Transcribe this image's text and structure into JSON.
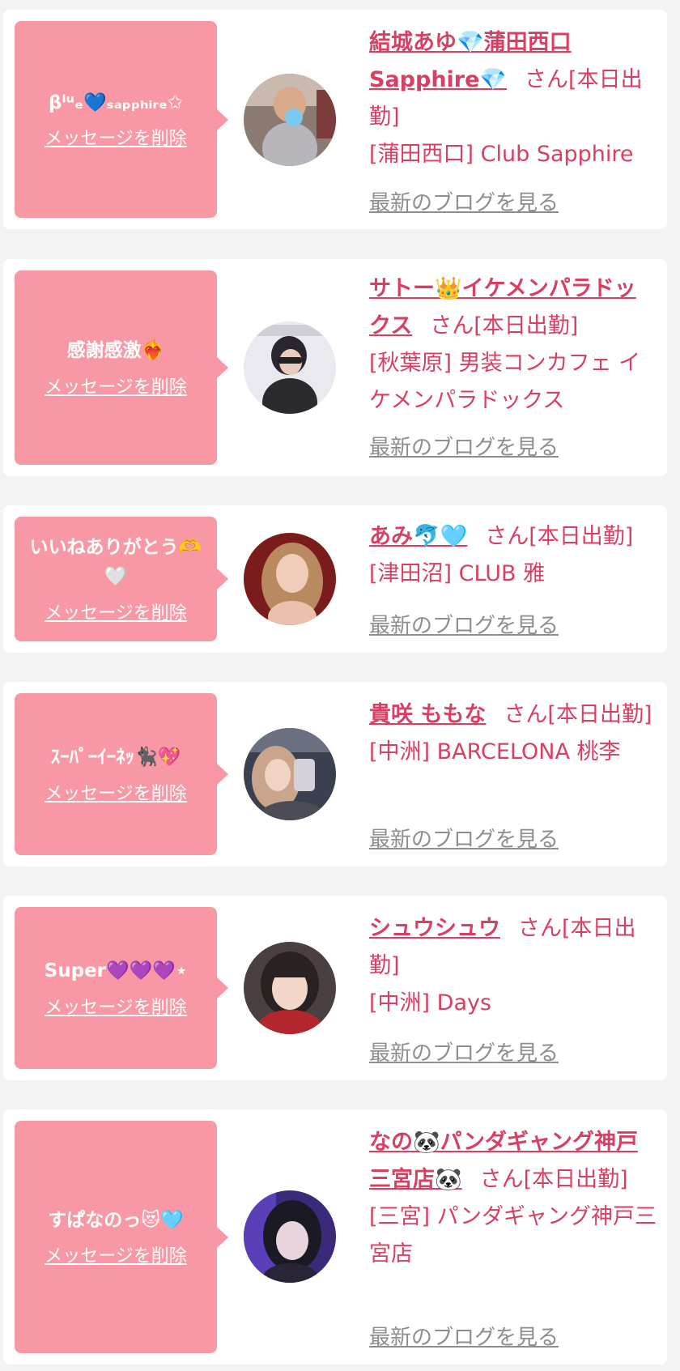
{
  "delete_label": "メッセージを削除",
  "blog_label": "最新のブログを見る",
  "san_suffix": "さん[本日出勤]",
  "colors": {
    "bubble": "#f898a4",
    "accent": "#d83f63",
    "link_gray": "#8d8d8d",
    "background": "#f3f3f3"
  },
  "messages": [
    {
      "message": "βˡᵘₑ💙ₛₐₚₚₕᵢᵣₑ✩",
      "cast_name": "結城あゆ💎蒲田西口Sapphire💎",
      "shop": "[蒲田西口] Club Sapphire"
    },
    {
      "message": "感謝感激❤️‍🔥",
      "cast_name": "サトー👑イケメンパラドックス",
      "shop": "[秋葉原] 男装コンカフェ イケメンパラドックス"
    },
    {
      "message": "いいねありがとう🫶🤍",
      "cast_name": "あみ🐬🩵",
      "shop": "[津田沼] CLUB 雅"
    },
    {
      "message": "ｽｰﾊﾟｰｲｰﾈｯ🐈‍⬛💖",
      "cast_name": "貴咲 ももな",
      "shop": "[中洲] BARCELONA 桃李"
    },
    {
      "message": "Super💜💜💜⋆",
      "cast_name": "シュウシュウ",
      "shop": "[中洲] Days"
    },
    {
      "message": "すぱなのっ😻🩵",
      "cast_name": "なの🐼パンダギャング神戸三宮店🐼",
      "shop": "[三宮] パンダギャング神戸三宮店"
    }
  ]
}
